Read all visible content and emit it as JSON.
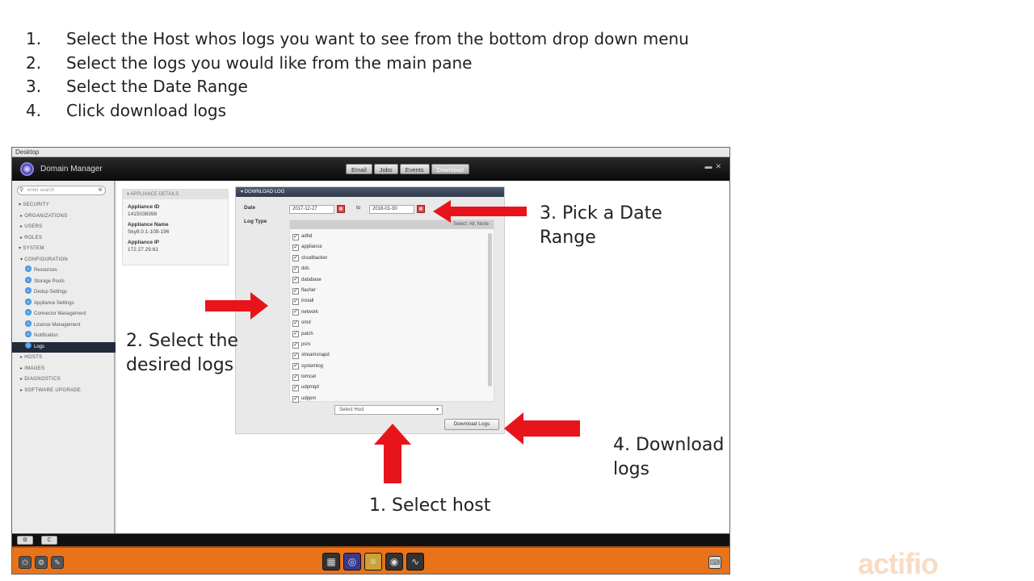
{
  "instructions": [
    {
      "num": "1.",
      "text": "Select the Host whos logs you want to see from the bottom drop down menu"
    },
    {
      "num": "2.",
      "text": "Select the logs you would like from the main pane"
    },
    {
      "num": "3.",
      "text": "Select the Date Range"
    },
    {
      "num": "4.",
      "text": "Click download logs"
    }
  ],
  "window": {
    "desktop_label": "Desktop",
    "app_title": "Domain Manager",
    "tabs": [
      "Email",
      "Jobs",
      "Events",
      "Download"
    ]
  },
  "sidebar": {
    "search_placeholder": "enter search",
    "items": [
      {
        "label": "SECURITY",
        "level": 0
      },
      {
        "label": "ORGANIZATIONS",
        "level": 1
      },
      {
        "label": "USERS",
        "level": 1
      },
      {
        "label": "ROLES",
        "level": 1
      },
      {
        "label": "SYSTEM",
        "level": 0
      },
      {
        "label": "CONFIGURATION",
        "level": 1
      },
      {
        "label": "Resources",
        "level": 2
      },
      {
        "label": "Storage Pools",
        "level": 2
      },
      {
        "label": "Dedup Settings",
        "level": 2
      },
      {
        "label": "Appliance Settings",
        "level": 2
      },
      {
        "label": "Connector Management",
        "level": 2
      },
      {
        "label": "License Management",
        "level": 2
      },
      {
        "label": "Notification",
        "level": 2
      },
      {
        "label": "Logs",
        "level": 2,
        "selected": true
      },
      {
        "label": "HOSTS",
        "level": 1
      },
      {
        "label": "IMAGES",
        "level": 1
      },
      {
        "label": "DIAGNOSTICS",
        "level": 1
      },
      {
        "label": "SOFTWARE UPGRADE",
        "level": 1
      }
    ]
  },
  "appliance": {
    "header": "APPLIANCE DETAILS",
    "id_label": "Appliance ID",
    "id_value": "1415038398",
    "name_label": "Appliance Name",
    "name_value": "Sky8.0.1-109-196",
    "ip_label": "Appliance IP",
    "ip_value": "172.27.29.61"
  },
  "download": {
    "header": "DOWNLOAD LOG",
    "date_label": "Date",
    "date_from": "2017-12-27",
    "to_label": "to",
    "date_to": "2018-01-30",
    "logtype_label": "Log Type",
    "select_all": "Select: All, None",
    "logs": [
      "adhd",
      "appliance",
      "cloudbacker",
      "dds",
      "database",
      "flasher",
      "install",
      "network",
      "omd",
      "patch",
      "psrv",
      "streamsnapd",
      "systemlog",
      "tomcat",
      "udpmqd",
      "udppm"
    ],
    "host_placeholder": "Select Host",
    "button": "Download Logs"
  },
  "annotations": {
    "date": "3. Pick a Date Range",
    "logs": "2. Select the desired logs",
    "host": "1. Select host",
    "download": "4. Download logs"
  },
  "brand": "actifio",
  "colors": {
    "arrow": "#e8141c",
    "taskbar": "#e8731a"
  }
}
